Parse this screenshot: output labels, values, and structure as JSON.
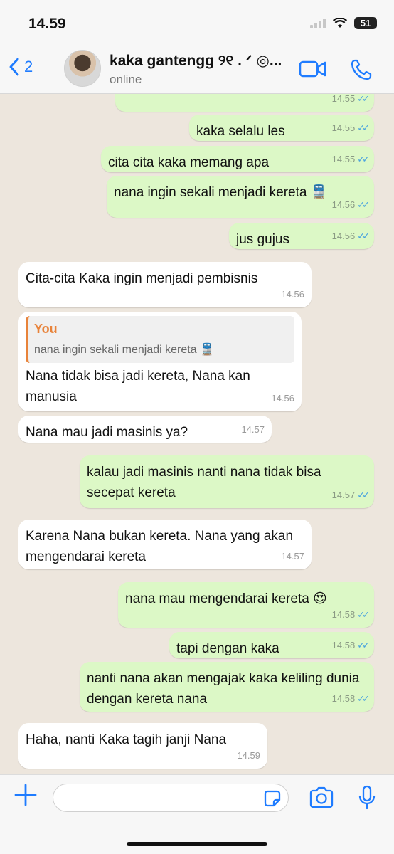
{
  "status_bar": {
    "time": "14.59",
    "battery": "51"
  },
  "header": {
    "back_count": "2",
    "contact_name": "kaka gantengg ୨୧ . ᐟ ◎...",
    "contact_status": "online"
  },
  "messages": [
    {
      "dir": "out",
      "text": "",
      "time": "14.55"
    },
    {
      "dir": "out",
      "text": "kaka selalu les",
      "time": "14.55"
    },
    {
      "dir": "out",
      "text": "cita cita kaka memang apa",
      "time": "14.55"
    },
    {
      "dir": "out",
      "text": "nana ingin sekali menjadi kereta 🚆",
      "time": "14.56"
    },
    {
      "dir": "out",
      "text": "jus gujus",
      "time": "14.56"
    },
    {
      "dir": "in",
      "text": "Cita-cita Kaka ingin menjadi pembisnis",
      "time": "14.56"
    },
    {
      "dir": "in",
      "quote_name": "You",
      "quote_text": "nana ingin sekali menjadi kereta 🚆",
      "text": "Nana tidak bisa jadi kereta, Nana kan manusia",
      "time": "14.56"
    },
    {
      "dir": "in",
      "text": "Nana mau jadi masinis ya?",
      "time": "14.57"
    },
    {
      "dir": "out",
      "text": "kalau jadi masinis nanti nana tidak bisa secepat kereta",
      "time": "14.57"
    },
    {
      "dir": "in",
      "text": "Karena Nana bukan kereta. Nana yang akan mengendarai kereta",
      "time": "14.57"
    },
    {
      "dir": "out",
      "text": "nana mau mengendarai kereta 😍",
      "time": "14.58"
    },
    {
      "dir": "out",
      "text": "tapi dengan kaka",
      "time": "14.58"
    },
    {
      "dir": "out",
      "text": "nanti nana akan mengajak kaka keliling dunia dengan kereta nana",
      "time": "14.58"
    },
    {
      "dir": "in",
      "text": "Haha, nanti Kaka tagih janji Nana",
      "time": "14.59"
    }
  ],
  "composer": {
    "placeholder": ""
  },
  "colors": {
    "accent": "#1f7cff",
    "outgoing": "#dcf8c6",
    "incoming": "#ffffff",
    "reply_name": "#e8833a"
  }
}
